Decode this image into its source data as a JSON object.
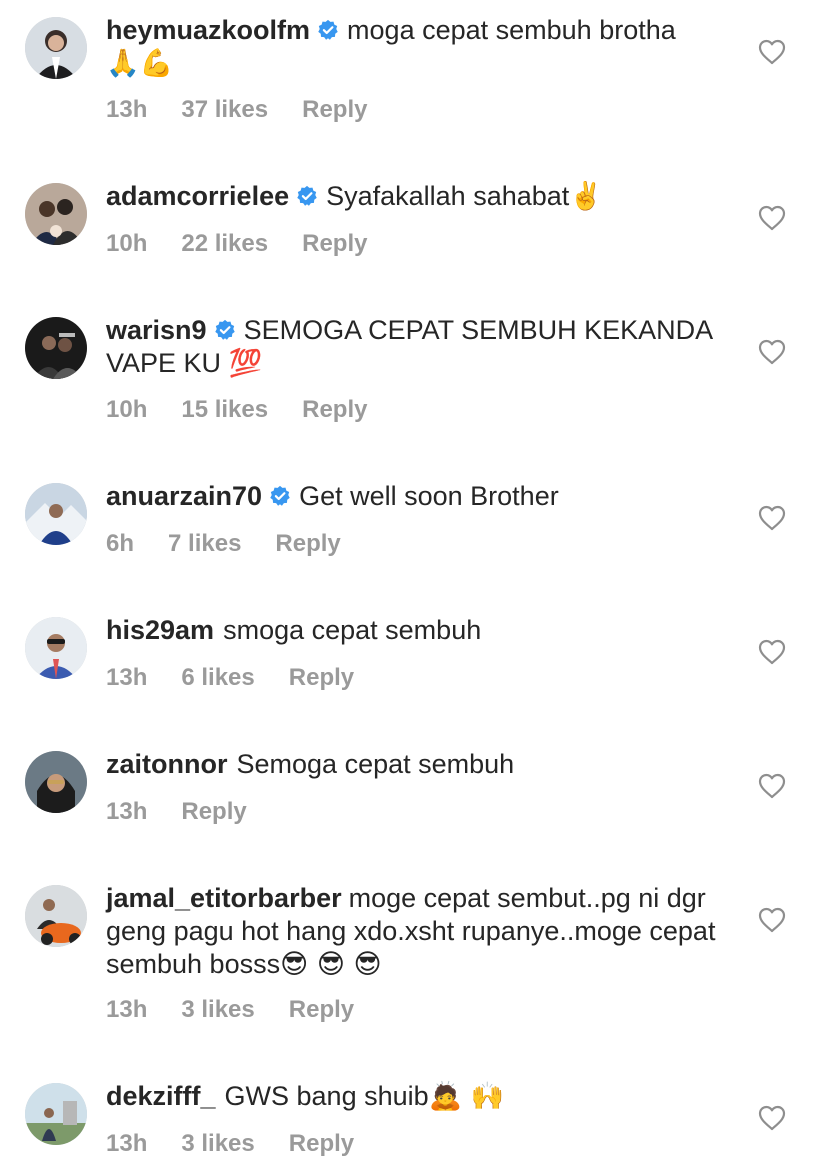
{
  "comments": [
    {
      "username": "heymuazkoolfm",
      "verified": true,
      "text": "moga cepat sembuh brotha",
      "emoji": "🙏💪",
      "time": "13h",
      "likes": "37 likes",
      "reply": "Reply"
    },
    {
      "username": "adamcorrielee",
      "verified": true,
      "text": "Syafakallah sahabat",
      "emoji": "✌️",
      "time": "10h",
      "likes": "22 likes",
      "reply": "Reply"
    },
    {
      "username": "warisn9",
      "verified": true,
      "text": "SEMOGA CEPAT SEMBUH KEKANDA VAPE KU",
      "emoji": "💯",
      "time": "10h",
      "likes": "15 likes",
      "reply": "Reply"
    },
    {
      "username": "anuarzain70",
      "verified": true,
      "text": "Get well soon Brother",
      "emoji": "",
      "time": "6h",
      "likes": "7 likes",
      "reply": "Reply"
    },
    {
      "username": "his29am",
      "verified": false,
      "text": "smoga cepat sembuh",
      "emoji": "",
      "time": "13h",
      "likes": "6 likes",
      "reply": "Reply"
    },
    {
      "username": "zaitonnor",
      "verified": false,
      "text": "Semoga cepat sembuh",
      "emoji": "",
      "time": "13h",
      "likes": "",
      "reply": "Reply"
    },
    {
      "username": "jamal_etitorbarber",
      "verified": false,
      "text": "moge cepat sembut..pg ni dgr geng pagu hot hang xdo.xsht rupanye..moge cepat sembuh bosss",
      "emoji": "😎 😎 😎",
      "time": "13h",
      "likes": "3 likes",
      "reply": "Reply"
    },
    {
      "username": "dekzifff_",
      "verified": false,
      "text": "GWS bang shuib",
      "emoji": "🙇 🙌",
      "time": "13h",
      "likes": "3 likes",
      "reply": "Reply"
    }
  ],
  "icons": {
    "heart": "heart-outline-icon",
    "verified": "verified-badge-icon"
  },
  "colors": {
    "text": "#262626",
    "meta": "#9a9a9a",
    "verified": "#3897f0",
    "heart": "#8e8e8e"
  }
}
